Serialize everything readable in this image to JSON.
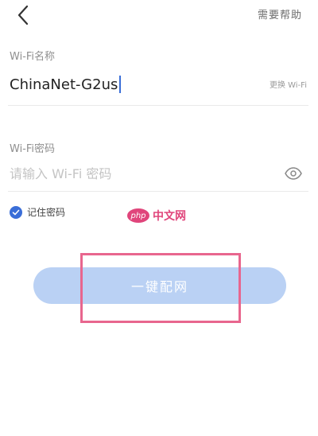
{
  "header": {
    "help_label": "需要帮助"
  },
  "ssid": {
    "label": "Wi-Fi名称",
    "value": "ChinaNet-G2us",
    "change_label": "更换 Wi-Fi"
  },
  "password": {
    "label": "Wi-Fi密码",
    "placeholder": "请输入 Wi-Fi 密码"
  },
  "remember": {
    "label": "记住密码",
    "checked": true
  },
  "watermark": {
    "badge": "php",
    "text": "中文网"
  },
  "connect": {
    "label": "一键配网"
  },
  "colors": {
    "accent": "#3a6ed8",
    "button_disabled": "#bad1f4",
    "highlight": "#e8668e"
  }
}
